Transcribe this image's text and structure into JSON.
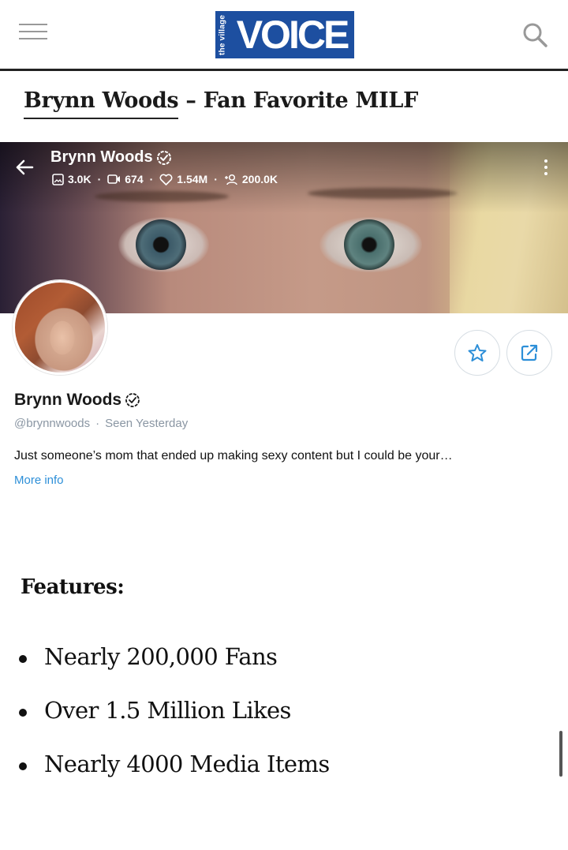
{
  "header": {
    "logo_small": "the village",
    "logo_main": "VOICE"
  },
  "article": {
    "title_name": "Brynn Woods",
    "title_rest": " – Fan Favorite MILF"
  },
  "profile": {
    "name": "Brynn Woods",
    "stats": {
      "photos": "3.0K",
      "videos": "674",
      "likes": "1.54M",
      "fans": "200.0K"
    },
    "handle": "@brynnwoods",
    "seen": "Seen Yesterday",
    "bio": "Just someone’s mom that ended up making sexy content but I could be your…",
    "more_info": "More info"
  },
  "features": {
    "heading": "Features:",
    "items": [
      "Nearly 200,000 Fans",
      "Over 1.5 Million Likes",
      "Nearly 4000 Media Items"
    ]
  },
  "colors": {
    "logo_blue": "#1d4fa0",
    "link_blue": "#2d8fd8",
    "meta_gray": "#8a96a3",
    "icon_blue": "#2d8fd8"
  },
  "icons": {
    "menu": "hamburger-icon",
    "search": "search-icon",
    "back": "arrow-left-icon",
    "verified": "verified-badge-icon",
    "more": "kebab-icon",
    "favorite": "star-icon",
    "share": "share-icon"
  }
}
